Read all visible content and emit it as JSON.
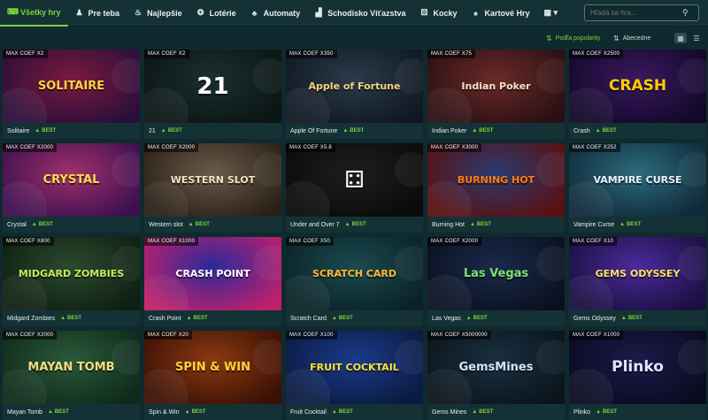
{
  "nav": {
    "items": [
      {
        "label": "Všetky hry",
        "icon": "gamepad-icon",
        "glyph": "⌨",
        "active": true
      },
      {
        "label": "Pre teba",
        "icon": "person-icon",
        "glyph": "♟"
      },
      {
        "label": "Najlepšie",
        "icon": "flame-icon",
        "glyph": "♨"
      },
      {
        "label": "Lotérie",
        "icon": "lottery-icon",
        "glyph": "❂"
      },
      {
        "label": "Automaty",
        "icon": "cherry-icon",
        "glyph": "♣"
      },
      {
        "label": "Schodisko Víťazstva",
        "icon": "stairs-icon",
        "glyph": "▟"
      },
      {
        "label": "Kocky",
        "icon": "dice-icon",
        "glyph": "⚄"
      },
      {
        "label": "Kartové Hry",
        "icon": "spade-icon",
        "glyph": "♠"
      },
      {
        "label": "",
        "icon": "grid-menu-icon",
        "glyph": "▦ ▾"
      }
    ],
    "search_placeholder": "Hľadá sa hra..."
  },
  "sort": {
    "popular": "Podľa popularity",
    "alpha": "Abecedne"
  },
  "best_label": "BEST",
  "games": [
    {
      "title": "Solitaire",
      "coef": "MAX COEF X2",
      "logo": "SOLITAIRE",
      "bg": "#7a1a3e",
      "bg2": "#2a0e3a",
      "fg": "#ffd23a"
    },
    {
      "title": "21",
      "coef": "MAX COEF X2",
      "logo": "21",
      "bg": "#1b2f2e",
      "bg2": "#0a1514",
      "fg": "#ffffff"
    },
    {
      "title": "Apple Of Fortune",
      "coef": "MAX COEF X350",
      "logo": "Apple of Fortune",
      "bg": "#2c3a4a",
      "bg2": "#0f1822",
      "fg": "#f3d27a"
    },
    {
      "title": "Indian Poker",
      "coef": "MAX COEF X75",
      "logo": "Indian Poker",
      "bg": "#6a2a2a",
      "bg2": "#2a0f12",
      "fg": "#f0e0c0"
    },
    {
      "title": "Crash",
      "coef": "MAX COEF X2500",
      "logo": "CRASH",
      "bg": "#3a1860",
      "bg2": "#120828",
      "fg": "#ffcc00"
    },
    {
      "title": "Crystal",
      "coef": "MAX COEF X2000",
      "logo": "CRYSTAL",
      "bg": "#a0306a",
      "bg2": "#3a1050",
      "fg": "#ffd84a"
    },
    {
      "title": "Western slot",
      "coef": "MAX COEF X2000",
      "logo": "WESTERN SLOT",
      "bg": "#6a5a48",
      "bg2": "#2a2018",
      "fg": "#f1e2c0"
    },
    {
      "title": "Under and Over 7",
      "coef": "MAX COEF X5.8",
      "logo": "⚃",
      "bg": "#1e1e1e",
      "bg2": "#0a0a0a",
      "fg": "#f4f4f4"
    },
    {
      "title": "Burning Hot",
      "coef": "MAX COEF X3000",
      "logo": "BURNING HOT",
      "bg": "#2a3a70",
      "bg2": "#5a1010",
      "fg": "#ff7a10"
    },
    {
      "title": "Vampire Curse",
      "coef": "MAX COEF X252",
      "logo": "VAMPIRE CURSE",
      "bg": "#2c6a7a",
      "bg2": "#0f2a3a",
      "fg": "#e8f2ff"
    },
    {
      "title": "Midgard Zombies",
      "coef": "MAX COEF X800",
      "logo": "MIDGARD ZOMBIES",
      "bg": "#2a4a2e",
      "bg2": "#0f1f12",
      "fg": "#c7e85a"
    },
    {
      "title": "Crash Point",
      "coef": "MAX COEF X1000",
      "logo": "CRASH POINT",
      "bg": "#2a2a9a",
      "bg2": "#c0206a",
      "fg": "#ffffff"
    },
    {
      "title": "Scratch Card",
      "coef": "MAX COEF X50",
      "logo": "SCRATCH CARD",
      "bg": "#1a4a50",
      "bg2": "#0a2226",
      "fg": "#ffb830"
    },
    {
      "title": "Las Vegas",
      "coef": "MAX COEF X2000",
      "logo": "Las Vegas",
      "bg": "#1a2a4a",
      "bg2": "#0a1020",
      "fg": "#7fe070"
    },
    {
      "title": "Gems Odyssey",
      "coef": "MAX COEF X10",
      "logo": "GEMS ODYSSEY",
      "bg": "#4a2a9a",
      "bg2": "#1a0f40",
      "fg": "#ffe066"
    },
    {
      "title": "Mayan Tomb",
      "coef": "MAX COEF X2000",
      "logo": "MAYAN TOMB",
      "bg": "#2a5a3a",
      "bg2": "#0f2a1a",
      "fg": "#f4dc80"
    },
    {
      "title": "Spin & Win",
      "coef": "MAX COEF X20",
      "logo": "SPIN & WIN",
      "bg": "#8a3a10",
      "bg2": "#3a1006",
      "fg": "#ffd23a"
    },
    {
      "title": "Fruit Cocktail",
      "coef": "MAX COEF X100",
      "logo": "FRUIT COCKTAIL",
      "bg": "#1a3a8a",
      "bg2": "#0a1a40",
      "fg": "#ffe030"
    },
    {
      "title": "Gems Mines",
      "coef": "MAX COEF X5000000",
      "logo": "GemsMines",
      "bg": "#1a3040",
      "bg2": "#0a141c",
      "fg": "#cfe6ff"
    },
    {
      "title": "Plinko",
      "coef": "MAX COEF X1000",
      "logo": "Plinko",
      "bg": "#1a1a4a",
      "bg2": "#0a0a20",
      "fg": "#dfe4ff"
    }
  ]
}
